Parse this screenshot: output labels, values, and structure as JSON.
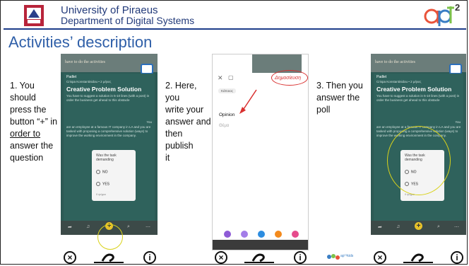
{
  "header": {
    "university": "University of Piraeus",
    "department": "Department of Digital Systems",
    "logo_text": "ap",
    "logo_superscript": "2"
  },
  "slide_title": "Activities’ description",
  "steps": [
    {
      "lines": [
        "1. You should",
        "press the",
        "button “+” in",
        "order to",
        "answer the",
        "question"
      ]
    },
    {
      "lines": [
        "2. Here, you",
        "write your",
        "answer and",
        "then publish",
        "it"
      ]
    },
    {
      "lines": [
        "3. Then you",
        "answer the",
        "poll"
      ]
    }
  ],
  "phone1": {
    "top_text": "have to do the activities",
    "username": "Padlet",
    "meta": "Crispa Konstantinidou • 2 μήνες",
    "card_title": "Creative Problem Solution",
    "desc": "You have to suggest a solution in 5-10 lines (with a post) in order the business get ahead to this obstacle",
    "you": "You",
    "scenario": "are an employee at a famous IT company in LA and you are tasked with proposing a comprehensive solution (ways) to improve the working environment in the company.",
    "poll_question": "Was the task demanding",
    "poll_options": [
      "NO",
      "YES"
    ],
    "votes": "0 ψήφοι",
    "plus": "+"
  },
  "phone2": {
    "publish_label": "Δημοσίευση",
    "author": "Κάποιος",
    "title_placeholder": "Θέμα",
    "answer_text": "Opinion"
  },
  "phone3": {
    "top_text": "have to do the activities",
    "username": "Padlet",
    "meta": "Crispa Konstantinidou • 2 μήνες",
    "card_title": "Creative Problem Solution",
    "desc": "You have to suggest a solution in 5-10 lines (with a post) in order the business get ahead to this obstacle",
    "you": "You",
    "scenario": "are an employee at a famous IT company in LA and you are tasked with proposing a comprehensive solution (ways) to improve the working environment in the company.",
    "poll_question": "Was the task demanding",
    "poll_options": [
      "NO",
      "YES"
    ],
    "votes": "0 ψήφοι",
    "plus": "+"
  },
  "controls": {
    "close": "×",
    "info": "i",
    "link": "🔗"
  },
  "footer_logo_text": "apᵀ²kids"
}
